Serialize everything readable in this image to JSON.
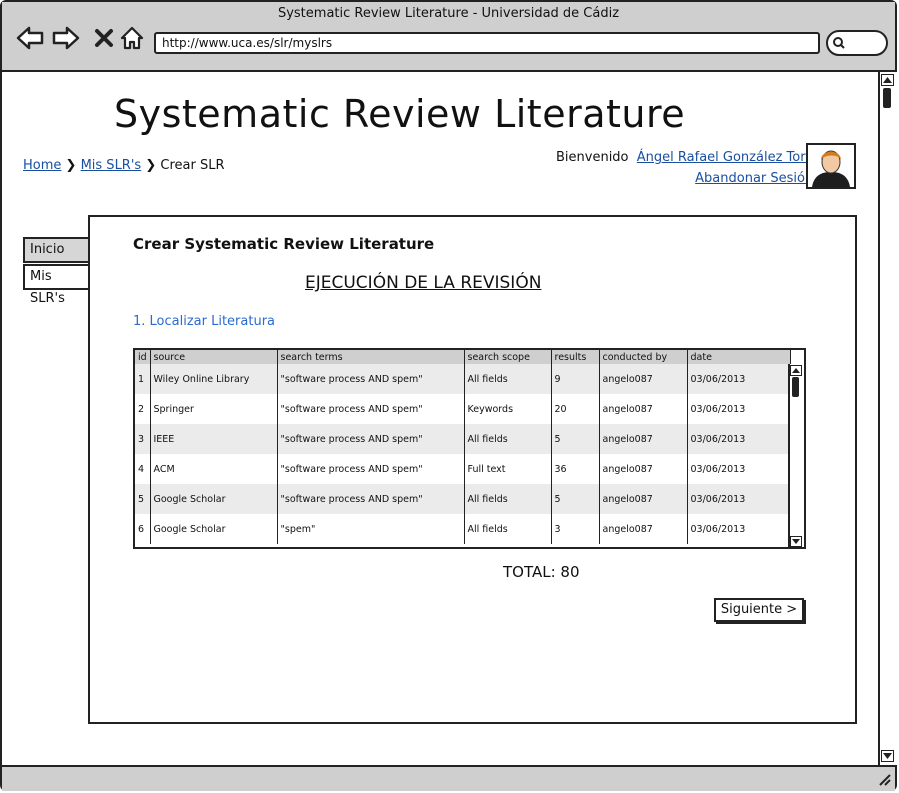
{
  "window": {
    "title": "Systematic Review Literature - Universidad de Cádiz"
  },
  "browser": {
    "url": "http://www.uca.es/slr/myslrs",
    "icons": [
      "back-icon",
      "forward-icon",
      "close-icon",
      "home-icon",
      "search-icon"
    ]
  },
  "header": {
    "title": "Systematic Review Literature",
    "breadcrumb": {
      "home": "Home",
      "mis": "Mis SLR's",
      "current": "Crear SLR"
    },
    "welcome": "Bienvenido",
    "user": "Ángel Rafael González Toro",
    "logout": "Abandonar Sesión"
  },
  "tabs": {
    "inicio": "Inicio",
    "mis": "Mis SLR's"
  },
  "panel": {
    "title": "Crear Systematic Review Literature",
    "section": "EJECUCIÓN DE LA REVISIÓN",
    "step": "1. Localizar Literatura"
  },
  "table": {
    "headers": [
      "id",
      "source",
      "search terms",
      "search scope",
      "results",
      "conducted by",
      "date"
    ],
    "rows": [
      [
        "1",
        "Wiley Online Library",
        "\"software process AND spem\"",
        "All fields",
        "9",
        "angelo087",
        "03/06/2013"
      ],
      [
        "2",
        "Springer",
        "\"software process AND spem\"",
        "Keywords",
        "20",
        "angelo087",
        "03/06/2013"
      ],
      [
        "3",
        "IEEE",
        "\"software process AND spem\"",
        "All fields",
        "5",
        "angelo087",
        "03/06/2013"
      ],
      [
        "4",
        "ACM",
        "\"software process AND spem\"",
        "Full text",
        "36",
        "angelo087",
        "03/06/2013"
      ],
      [
        "5",
        "Google Scholar",
        "\"software process AND spem\"",
        "All fields",
        "5",
        "angelo087",
        "03/06/2013"
      ],
      [
        "6",
        "Google Scholar",
        "\"spem\"",
        "All fields",
        "3",
        "angelo087",
        "03/06/2013"
      ]
    ]
  },
  "total": "TOTAL: 80",
  "next_button": "Siguiente >",
  "colors": {
    "link": "#1a4fa0",
    "step_link": "#2a6bd0",
    "chrome": "#cfcfcf"
  }
}
